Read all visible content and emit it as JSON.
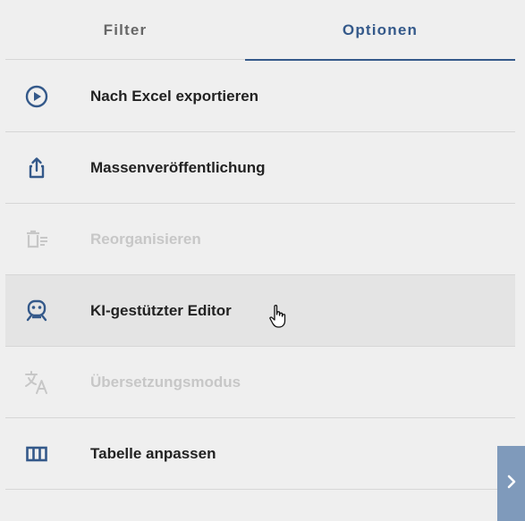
{
  "tabs": [
    {
      "label": "Filter",
      "active": false
    },
    {
      "label": "Optionen",
      "active": true
    }
  ],
  "menu": {
    "items": [
      {
        "label": "Nach Excel exportieren",
        "icon": "play-circle-icon",
        "enabled": true
      },
      {
        "label": "Massenveröffentlichung",
        "icon": "share-upload-icon",
        "enabled": true
      },
      {
        "label": "Reorganisieren",
        "icon": "reorganize-icon",
        "enabled": false
      },
      {
        "label": "KI-gestützter Editor",
        "icon": "robot-icon",
        "enabled": true,
        "hovered": true
      },
      {
        "label": "Übersetzungsmodus",
        "icon": "translate-icon",
        "enabled": false
      },
      {
        "label": "Tabelle anpassen",
        "icon": "table-columns-icon",
        "enabled": true
      }
    ]
  },
  "side_toggle": {
    "icon": "chevron-right-icon"
  },
  "colors": {
    "accent": "#34598a",
    "background": "#efefef",
    "hover": "#e4e4e4",
    "disabled": "#c7c7c7",
    "side_toggle": "#7f9abb"
  }
}
